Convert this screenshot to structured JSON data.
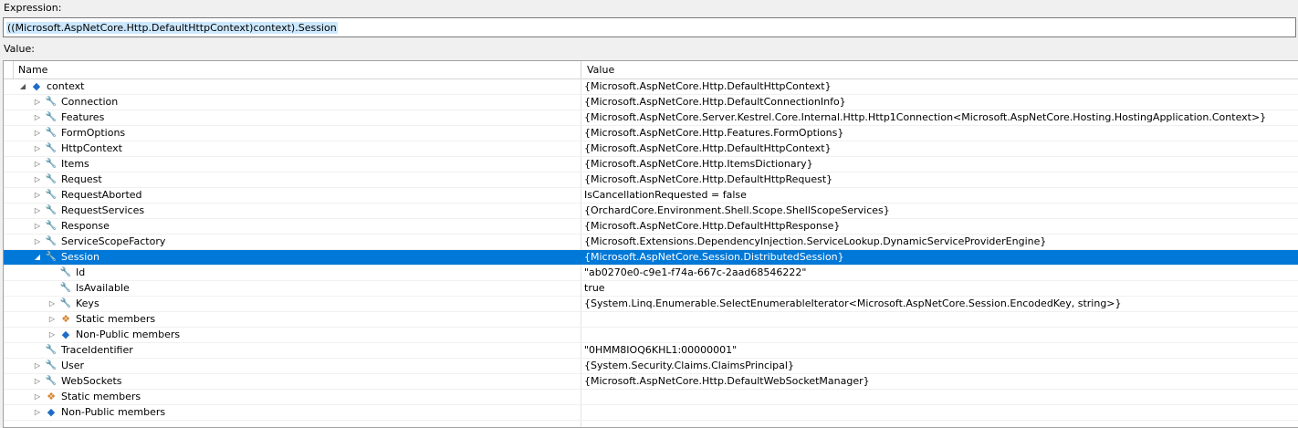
{
  "expression": {
    "label": "Expression:",
    "value": "((Microsoft.AspNetCore.Http.DefaultHttpContext)context).Session"
  },
  "value_label": "Value:",
  "columns": {
    "name": "Name",
    "value": "Value"
  },
  "icons": {
    "property": "wrench-icon",
    "object": "cube-icon",
    "static": "static-members-icon"
  },
  "colors": {
    "selection": "#0078d7",
    "expression_highlight": "#cce8ff"
  },
  "rows": [
    {
      "name": "context",
      "value": "{Microsoft.AspNetCore.Http.DefaultHttpContext}",
      "icon": "cube",
      "expander": "expanded",
      "level": 0
    },
    {
      "name": "Connection",
      "value": "{Microsoft.AspNetCore.Http.DefaultConnectionInfo}",
      "icon": "wrench",
      "expander": "collapsed",
      "level": 1
    },
    {
      "name": "Features",
      "value": "{Microsoft.AspNetCore.Server.Kestrel.Core.Internal.Http.Http1Connection<Microsoft.AspNetCore.Hosting.HostingApplication.Context>}",
      "icon": "wrench",
      "expander": "collapsed",
      "level": 1
    },
    {
      "name": "FormOptions",
      "value": "{Microsoft.AspNetCore.Http.Features.FormOptions}",
      "icon": "wrench",
      "expander": "collapsed",
      "level": 1
    },
    {
      "name": "HttpContext",
      "value": "{Microsoft.AspNetCore.Http.DefaultHttpContext}",
      "icon": "wrench",
      "expander": "collapsed",
      "level": 1
    },
    {
      "name": "Items",
      "value": "{Microsoft.AspNetCore.Http.ItemsDictionary}",
      "icon": "wrench",
      "expander": "collapsed",
      "level": 1
    },
    {
      "name": "Request",
      "value": "{Microsoft.AspNetCore.Http.DefaultHttpRequest}",
      "icon": "wrench",
      "expander": "collapsed",
      "level": 1
    },
    {
      "name": "RequestAborted",
      "value": "IsCancellationRequested = false",
      "icon": "wrench",
      "expander": "collapsed",
      "level": 1
    },
    {
      "name": "RequestServices",
      "value": "{OrchardCore.Environment.Shell.Scope.ShellScopeServices}",
      "icon": "wrench",
      "expander": "collapsed",
      "level": 1
    },
    {
      "name": "Response",
      "value": "{Microsoft.AspNetCore.Http.DefaultHttpResponse}",
      "icon": "wrench",
      "expander": "collapsed",
      "level": 1
    },
    {
      "name": "ServiceScopeFactory",
      "value": "{Microsoft.Extensions.DependencyInjection.ServiceLookup.DynamicServiceProviderEngine}",
      "icon": "wrench",
      "expander": "collapsed",
      "level": 1
    },
    {
      "name": "Session",
      "value": "{Microsoft.AspNetCore.Session.DistributedSession}",
      "icon": "wrench",
      "expander": "expanded",
      "level": 1,
      "selected": true
    },
    {
      "name": "Id",
      "value": "\"ab0270e0-c9e1-f74a-667c-2aad68546222\"",
      "icon": "wrench",
      "expander": "none",
      "level": 2
    },
    {
      "name": "IsAvailable",
      "value": "true",
      "icon": "wrench",
      "expander": "none",
      "level": 2
    },
    {
      "name": "Keys",
      "value": "{System.Linq.Enumerable.SelectEnumerableIterator<Microsoft.AspNetCore.Session.EncodedKey, string>}",
      "icon": "wrench",
      "expander": "collapsed",
      "level": 2
    },
    {
      "name": "Static members",
      "value": "",
      "icon": "static",
      "expander": "collapsed",
      "level": 2
    },
    {
      "name": "Non-Public members",
      "value": "",
      "icon": "cube",
      "expander": "collapsed",
      "level": 2
    },
    {
      "name": "TraceIdentifier",
      "value": "\"0HMM8IOQ6KHL1:00000001\"",
      "icon": "wrench",
      "expander": "none",
      "level": 1
    },
    {
      "name": "User",
      "value": "{System.Security.Claims.ClaimsPrincipal}",
      "icon": "wrench",
      "expander": "collapsed",
      "level": 1
    },
    {
      "name": "WebSockets",
      "value": "{Microsoft.AspNetCore.Http.DefaultWebSocketManager}",
      "icon": "wrench",
      "expander": "collapsed",
      "level": 1
    },
    {
      "name": "Static members",
      "value": "",
      "icon": "static",
      "expander": "collapsed",
      "level": 1
    },
    {
      "name": "Non-Public members",
      "value": "",
      "icon": "cube",
      "expander": "collapsed",
      "level": 1
    }
  ]
}
